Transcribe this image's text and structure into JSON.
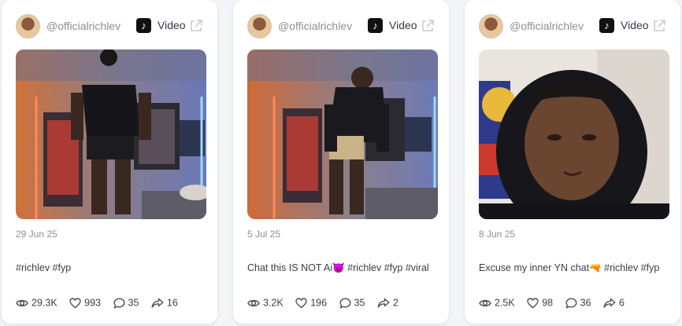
{
  "cards": [
    {
      "handle": "@officialrichlev",
      "type_label": "Video",
      "date": "29 Jun 25",
      "caption": "#richlev #fyp",
      "stats": {
        "views": "29.3K",
        "likes": "993",
        "comments": "35",
        "shares": "16"
      }
    },
    {
      "handle": "@officialrichlev",
      "type_label": "Video",
      "date": "5 Jul 25",
      "caption": "Chat this IS NOT Ai👿 #richlev #fyp #viral",
      "stats": {
        "views": "3.2K",
        "likes": "196",
        "comments": "35",
        "shares": "2"
      }
    },
    {
      "handle": "@officialrichlev",
      "type_label": "Video",
      "date": "8 Jun 25",
      "caption": "Excuse my inner YN chat🔫 #richlev #fyp",
      "stats": {
        "views": "2.5K",
        "likes": "98",
        "comments": "36",
        "shares": "6"
      }
    }
  ],
  "icons": {
    "platform": "tiktok-icon",
    "external": "external-link-icon",
    "views": "eye-icon",
    "likes": "heart-icon",
    "comments": "comment-icon",
    "shares": "share-icon"
  }
}
